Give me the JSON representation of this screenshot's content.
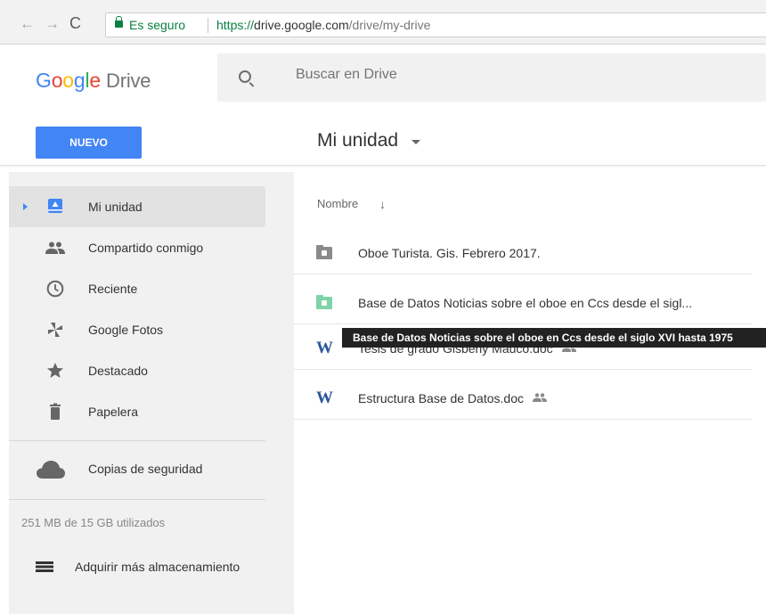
{
  "browser": {
    "back_glyph": "←",
    "forward_glyph": "→",
    "reload_glyph": "C",
    "secure_label": "Es seguro",
    "url_scheme": "https://",
    "url_host": "drive.google.com",
    "url_path": "/drive/my-drive"
  },
  "header": {
    "logo_letters": [
      "G",
      "o",
      "o",
      "g",
      "l",
      "e"
    ],
    "logo_product": "Drive",
    "search_placeholder": "Buscar en Drive",
    "new_button_label": "NUEVO",
    "location_title": "Mi unidad"
  },
  "sidebar": {
    "items": [
      {
        "label": "Mi unidad",
        "icon": "my-drive-icon",
        "active": true
      },
      {
        "label": "Compartido conmigo",
        "icon": "shared-people-icon"
      },
      {
        "label": "Reciente",
        "icon": "clock-icon"
      },
      {
        "label": "Google Fotos",
        "icon": "pinwheel-icon"
      },
      {
        "label": "Destacado",
        "icon": "star-icon"
      },
      {
        "label": "Papelera",
        "icon": "trash-icon"
      },
      {
        "label": "Copias de seguridad",
        "icon": "cloud-icon"
      }
    ],
    "storage_text": "251 MB de 15 GB utilizados",
    "buy_storage_label": "Adquirir más almacenamiento"
  },
  "file_list": {
    "column_name": "Nombre",
    "sort_glyph": "↓",
    "files": [
      {
        "name": "Oboe Turista. Gis. Febrero 2017.",
        "type": "folder",
        "color": "#8a8a8a",
        "shared": false
      },
      {
        "name": "Base de Datos Noticias sobre el oboe en Ccs desde el sigl...",
        "type": "folder",
        "color": "#7ed3a8",
        "shared": false
      },
      {
        "name": "Tesis de grado Gisberly Mauco.doc",
        "type": "word",
        "word_glyph": "W",
        "shared": true
      },
      {
        "name": "Estructura Base de Datos.doc",
        "type": "word",
        "word_glyph": "W",
        "shared": true
      }
    ],
    "tooltip": "Base de Datos Noticias sobre el oboe en Ccs desde el siglo XVI hasta 1975"
  },
  "colors": {
    "brand_blue": "#4285f4",
    "secure_green": "#0b8043"
  }
}
